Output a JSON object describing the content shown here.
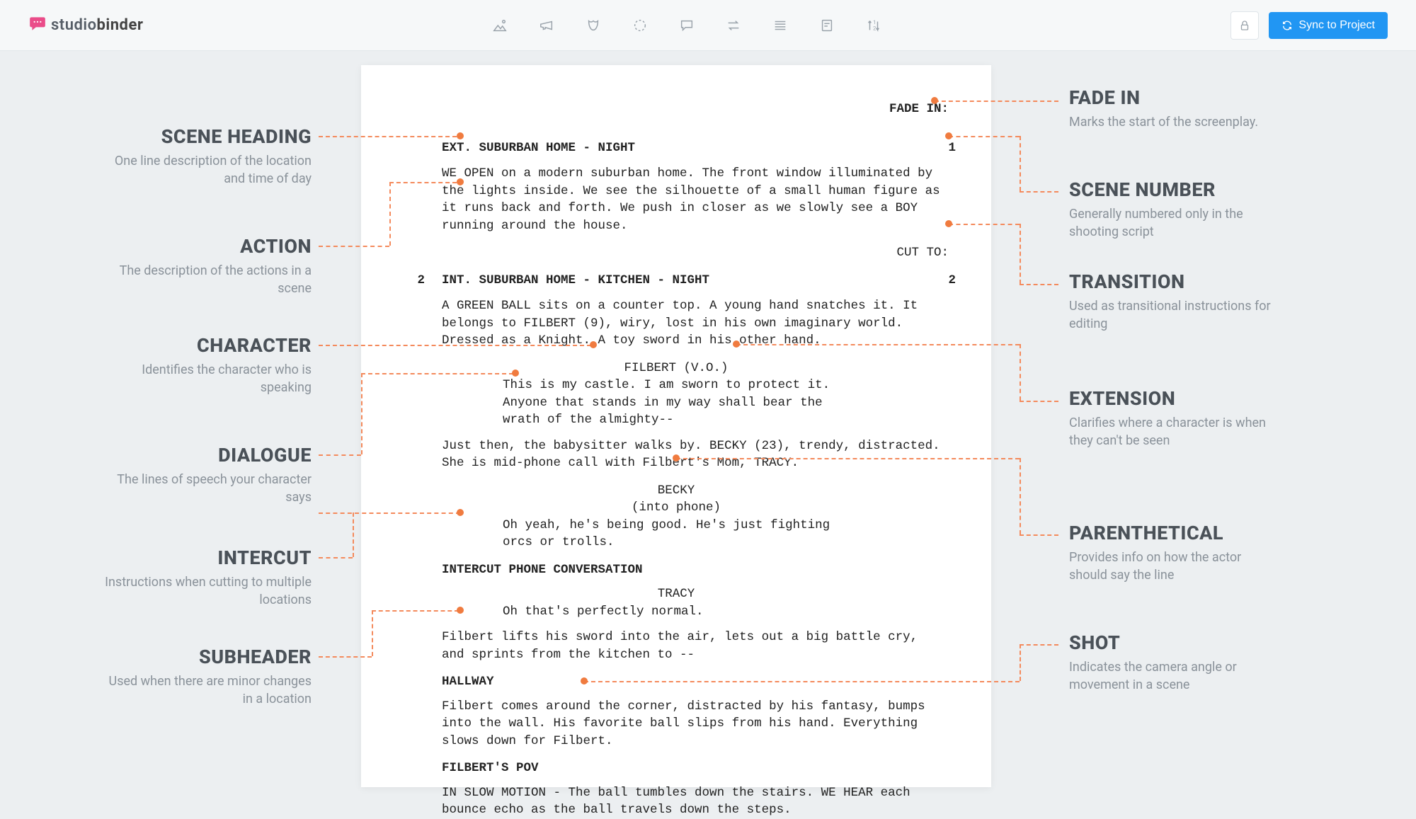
{
  "brand": {
    "name_light": "studio",
    "name_bold": "binder"
  },
  "sync_button": "Sync to Project",
  "script": {
    "fade_in": "FADE IN:",
    "scene1": {
      "num": "1",
      "heading": "EXT. SUBURBAN HOME - NIGHT"
    },
    "action1": "WE OPEN on a modern suburban home. The front window illuminated by the lights inside. We see the silhouette of a small human figure as it runs back and forth. We push in closer as we slowly see a BOY running around the house.",
    "cut_to": "CUT TO:",
    "scene2": {
      "num": "2",
      "heading": "INT. SUBURBAN HOME - KITCHEN - NIGHT"
    },
    "action2": "A GREEN BALL sits on a counter top. A young hand snatches it. It belongs to FILBERT (9), wiry, lost in his own imaginary world. Dressed as a Knight. A toy sword in his other hand.",
    "char_filbert": "FILBERT (V.O.)",
    "dlg_filbert": "This is my castle. I am sworn to protect it. Anyone that stands in my way shall bear the wrath of the almighty--",
    "action3": "Just then, the babysitter walks by. BECKY (23), trendy, distracted. She is mid-phone call with Filbert's Mom, TRACY.",
    "char_becky": "BECKY",
    "paren_becky": "(into phone)",
    "dlg_becky": "Oh yeah, he's being good. He's just fighting orcs or trolls.",
    "intercut": "INTERCUT PHONE CONVERSATION",
    "char_tracy": "TRACY",
    "dlg_tracy": "Oh that's perfectly normal.",
    "action4": "Filbert lifts his sword into the air, lets out a big battle cry, and sprints from the kitchen to --",
    "hallway": "HALLWAY",
    "action5": "Filbert comes around the corner, distracted by his fantasy, bumps into the wall. His favorite ball slips from his hand. Everything slows down for Filbert.",
    "pov": "FILBERT'S POV",
    "action6": "IN SLOW MOTION - The ball tumbles down the stairs. WE HEAR each bounce echo as the ball travels down the steps."
  },
  "callouts": {
    "left": [
      {
        "title": "SCENE HEADING",
        "desc": "One line description of the location and time of day"
      },
      {
        "title": "ACTION",
        "desc": "The description of the actions in a scene"
      },
      {
        "title": "CHARACTER",
        "desc": "Identifies the character who is speaking"
      },
      {
        "title": "DIALOGUE",
        "desc": "The lines of speech your character says"
      },
      {
        "title": "INTERCUT",
        "desc": "Instructions when cutting to multiple locations"
      },
      {
        "title": "SUBHEADER",
        "desc": "Used when there are minor changes in a location"
      }
    ],
    "right": [
      {
        "title": "FADE IN",
        "desc": "Marks the start of the screenplay."
      },
      {
        "title": "SCENE NUMBER",
        "desc": "Generally numbered only in the shooting script"
      },
      {
        "title": "TRANSITION",
        "desc": "Used as transitional instructions for editing"
      },
      {
        "title": "EXTENSION",
        "desc": "Clarifies where a character is when they can't be seen"
      },
      {
        "title": "PARENTHETICAL",
        "desc": "Provides info on how the actor should say the line"
      },
      {
        "title": "SHOT",
        "desc": "Indicates the camera angle or movement in a scene"
      }
    ]
  }
}
